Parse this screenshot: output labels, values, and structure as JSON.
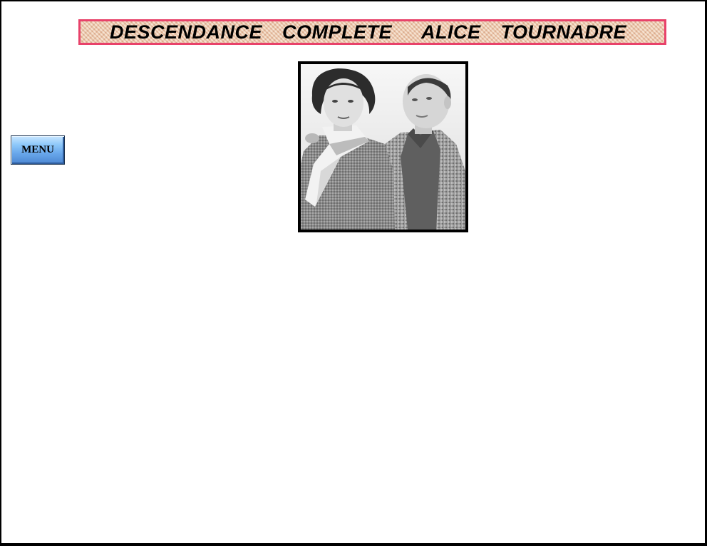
{
  "header": {
    "title": "DESCENDANCE  COMPLETE   ALICE  TOURNADRE",
    "border_color": "#e8426a"
  },
  "nav": {
    "menu_label": "MENU"
  },
  "photo": {
    "subject": "black-and-white portrait photograph of a woman and a man"
  }
}
